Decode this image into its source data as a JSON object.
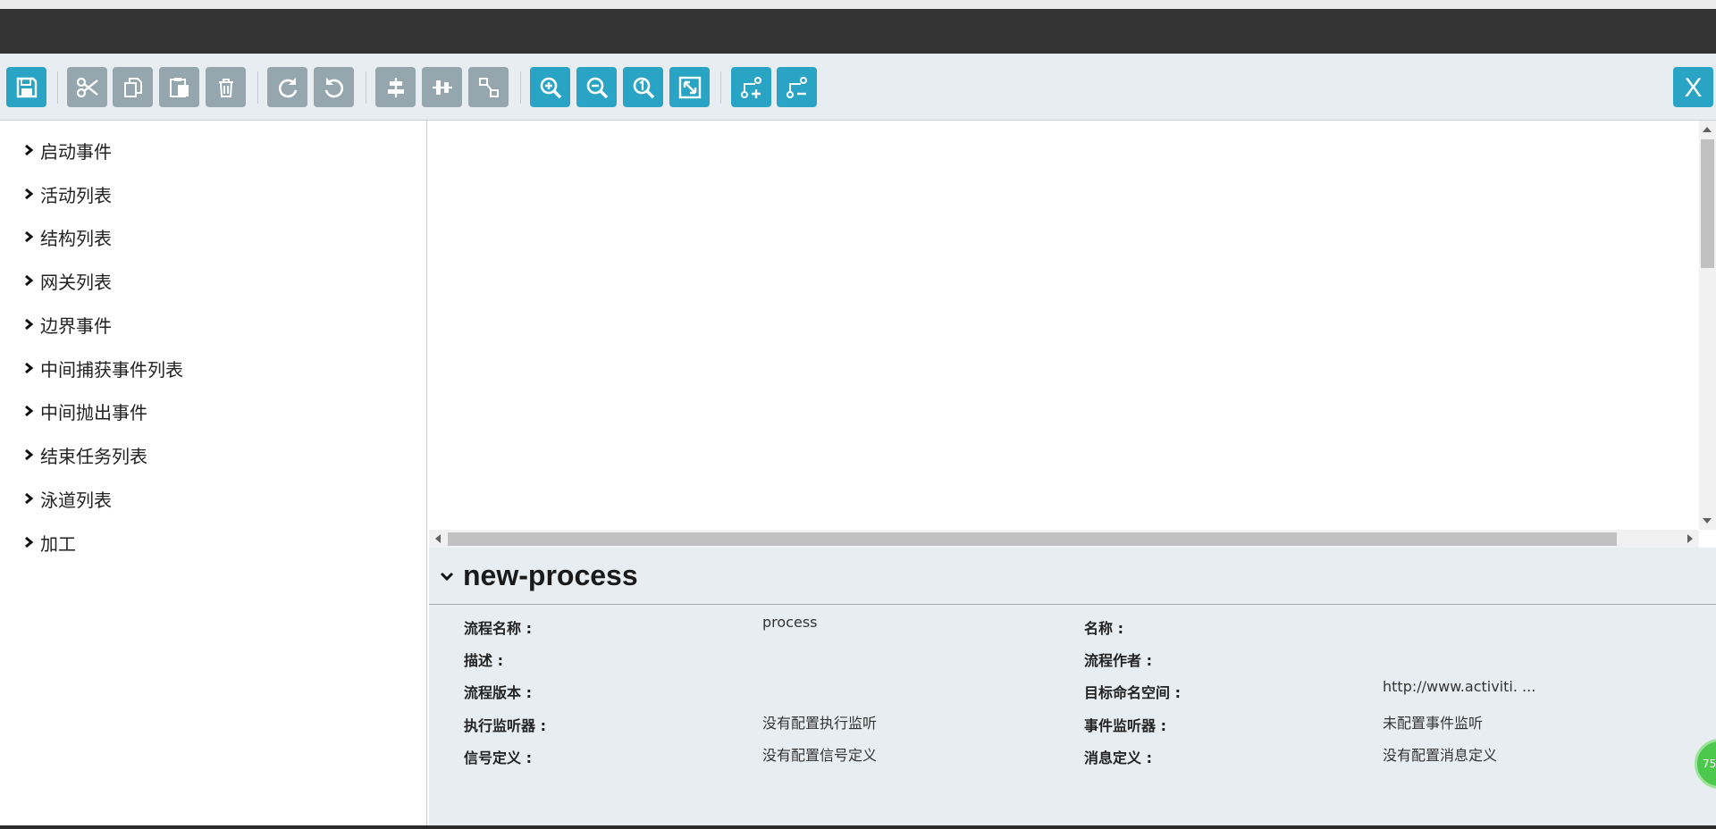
{
  "toolbar": {
    "buttons": [
      {
        "icon": "save-icon",
        "color": "blue"
      },
      {
        "icon": "cut-icon",
        "color": "gray"
      },
      {
        "icon": "copy-icon",
        "color": "gray"
      },
      {
        "icon": "paste-icon",
        "color": "gray"
      },
      {
        "icon": "delete-icon",
        "color": "gray"
      },
      {
        "icon": "redo-icon",
        "color": "gray"
      },
      {
        "icon": "undo-icon",
        "color": "gray"
      },
      {
        "icon": "align-horizontal-icon",
        "color": "gray"
      },
      {
        "icon": "align-vertical-icon",
        "color": "gray"
      },
      {
        "icon": "same-size-icon",
        "color": "gray"
      },
      {
        "icon": "zoom-in-icon",
        "color": "blue"
      },
      {
        "icon": "zoom-out-icon",
        "color": "blue"
      },
      {
        "icon": "zoom-actual-icon",
        "color": "blue"
      },
      {
        "icon": "zoom-fit-icon",
        "color": "blue"
      },
      {
        "icon": "add-bendpoint-icon",
        "color": "blue"
      },
      {
        "icon": "remove-bendpoint-icon",
        "color": "blue"
      }
    ],
    "close_label": "X",
    "colors": {
      "blue": "#2aa4c5",
      "gray": "#95a6ae",
      "background": "#e8edf1"
    }
  },
  "sidebar": {
    "items": [
      {
        "label": "启动事件"
      },
      {
        "label": "活动列表"
      },
      {
        "label": "结构列表"
      },
      {
        "label": "网关列表"
      },
      {
        "label": "边界事件"
      },
      {
        "label": "中间捕获事件列表"
      },
      {
        "label": "中间抛出事件"
      },
      {
        "label": "结束任务列表"
      },
      {
        "label": "泳道列表"
      },
      {
        "label": "加工"
      }
    ]
  },
  "properties": {
    "title": "new-process",
    "rows": [
      {
        "label": "流程名称 :",
        "value": "process",
        "label2": "名称 :",
        "value2": ""
      },
      {
        "label": "描述 :",
        "value": "",
        "label2": "流程作者 :",
        "value2": ""
      },
      {
        "label": "流程版本 :",
        "value": "",
        "label2": "目标命名空间 :",
        "value2": "http://www.activiti. ..."
      },
      {
        "label": "执行监听器 :",
        "value": "没有配置执行监听",
        "label2": "事件监听器 :",
        "value2": "未配置事件监听"
      },
      {
        "label": "信号定义 :",
        "value": "没有配置信号定义",
        "label2": "消息定义 :",
        "value2": "没有配置消息定义"
      }
    ]
  },
  "badge": {
    "text": "75"
  }
}
